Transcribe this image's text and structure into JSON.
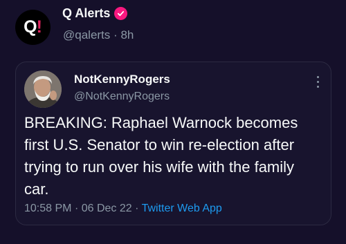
{
  "outer_tweet": {
    "avatar_letter": "Q",
    "avatar_mark": "!",
    "display_name": "Q Alerts",
    "handle": "@qalerts",
    "separator": "·",
    "time_ago": "8h"
  },
  "quoted_tweet": {
    "display_name": "NotKennyRogers",
    "handle": "@NotKennyRogers",
    "text": "BREAKING: Raphael Warnock becomes first U.S. Senator to win re-election after trying to run over his wife with the family car.",
    "time": "10:58 PM",
    "sep1": "·",
    "date": "06 Dec 22",
    "sep2": "·",
    "source": "Twitter Web App"
  },
  "colors": {
    "background": "#15102a",
    "verified_badge": "#f91880",
    "link": "#1d9bf0",
    "secondary_text": "#8b98a5"
  },
  "icons": {
    "verified": "verified-badge-icon",
    "more": "more-options-icon"
  }
}
